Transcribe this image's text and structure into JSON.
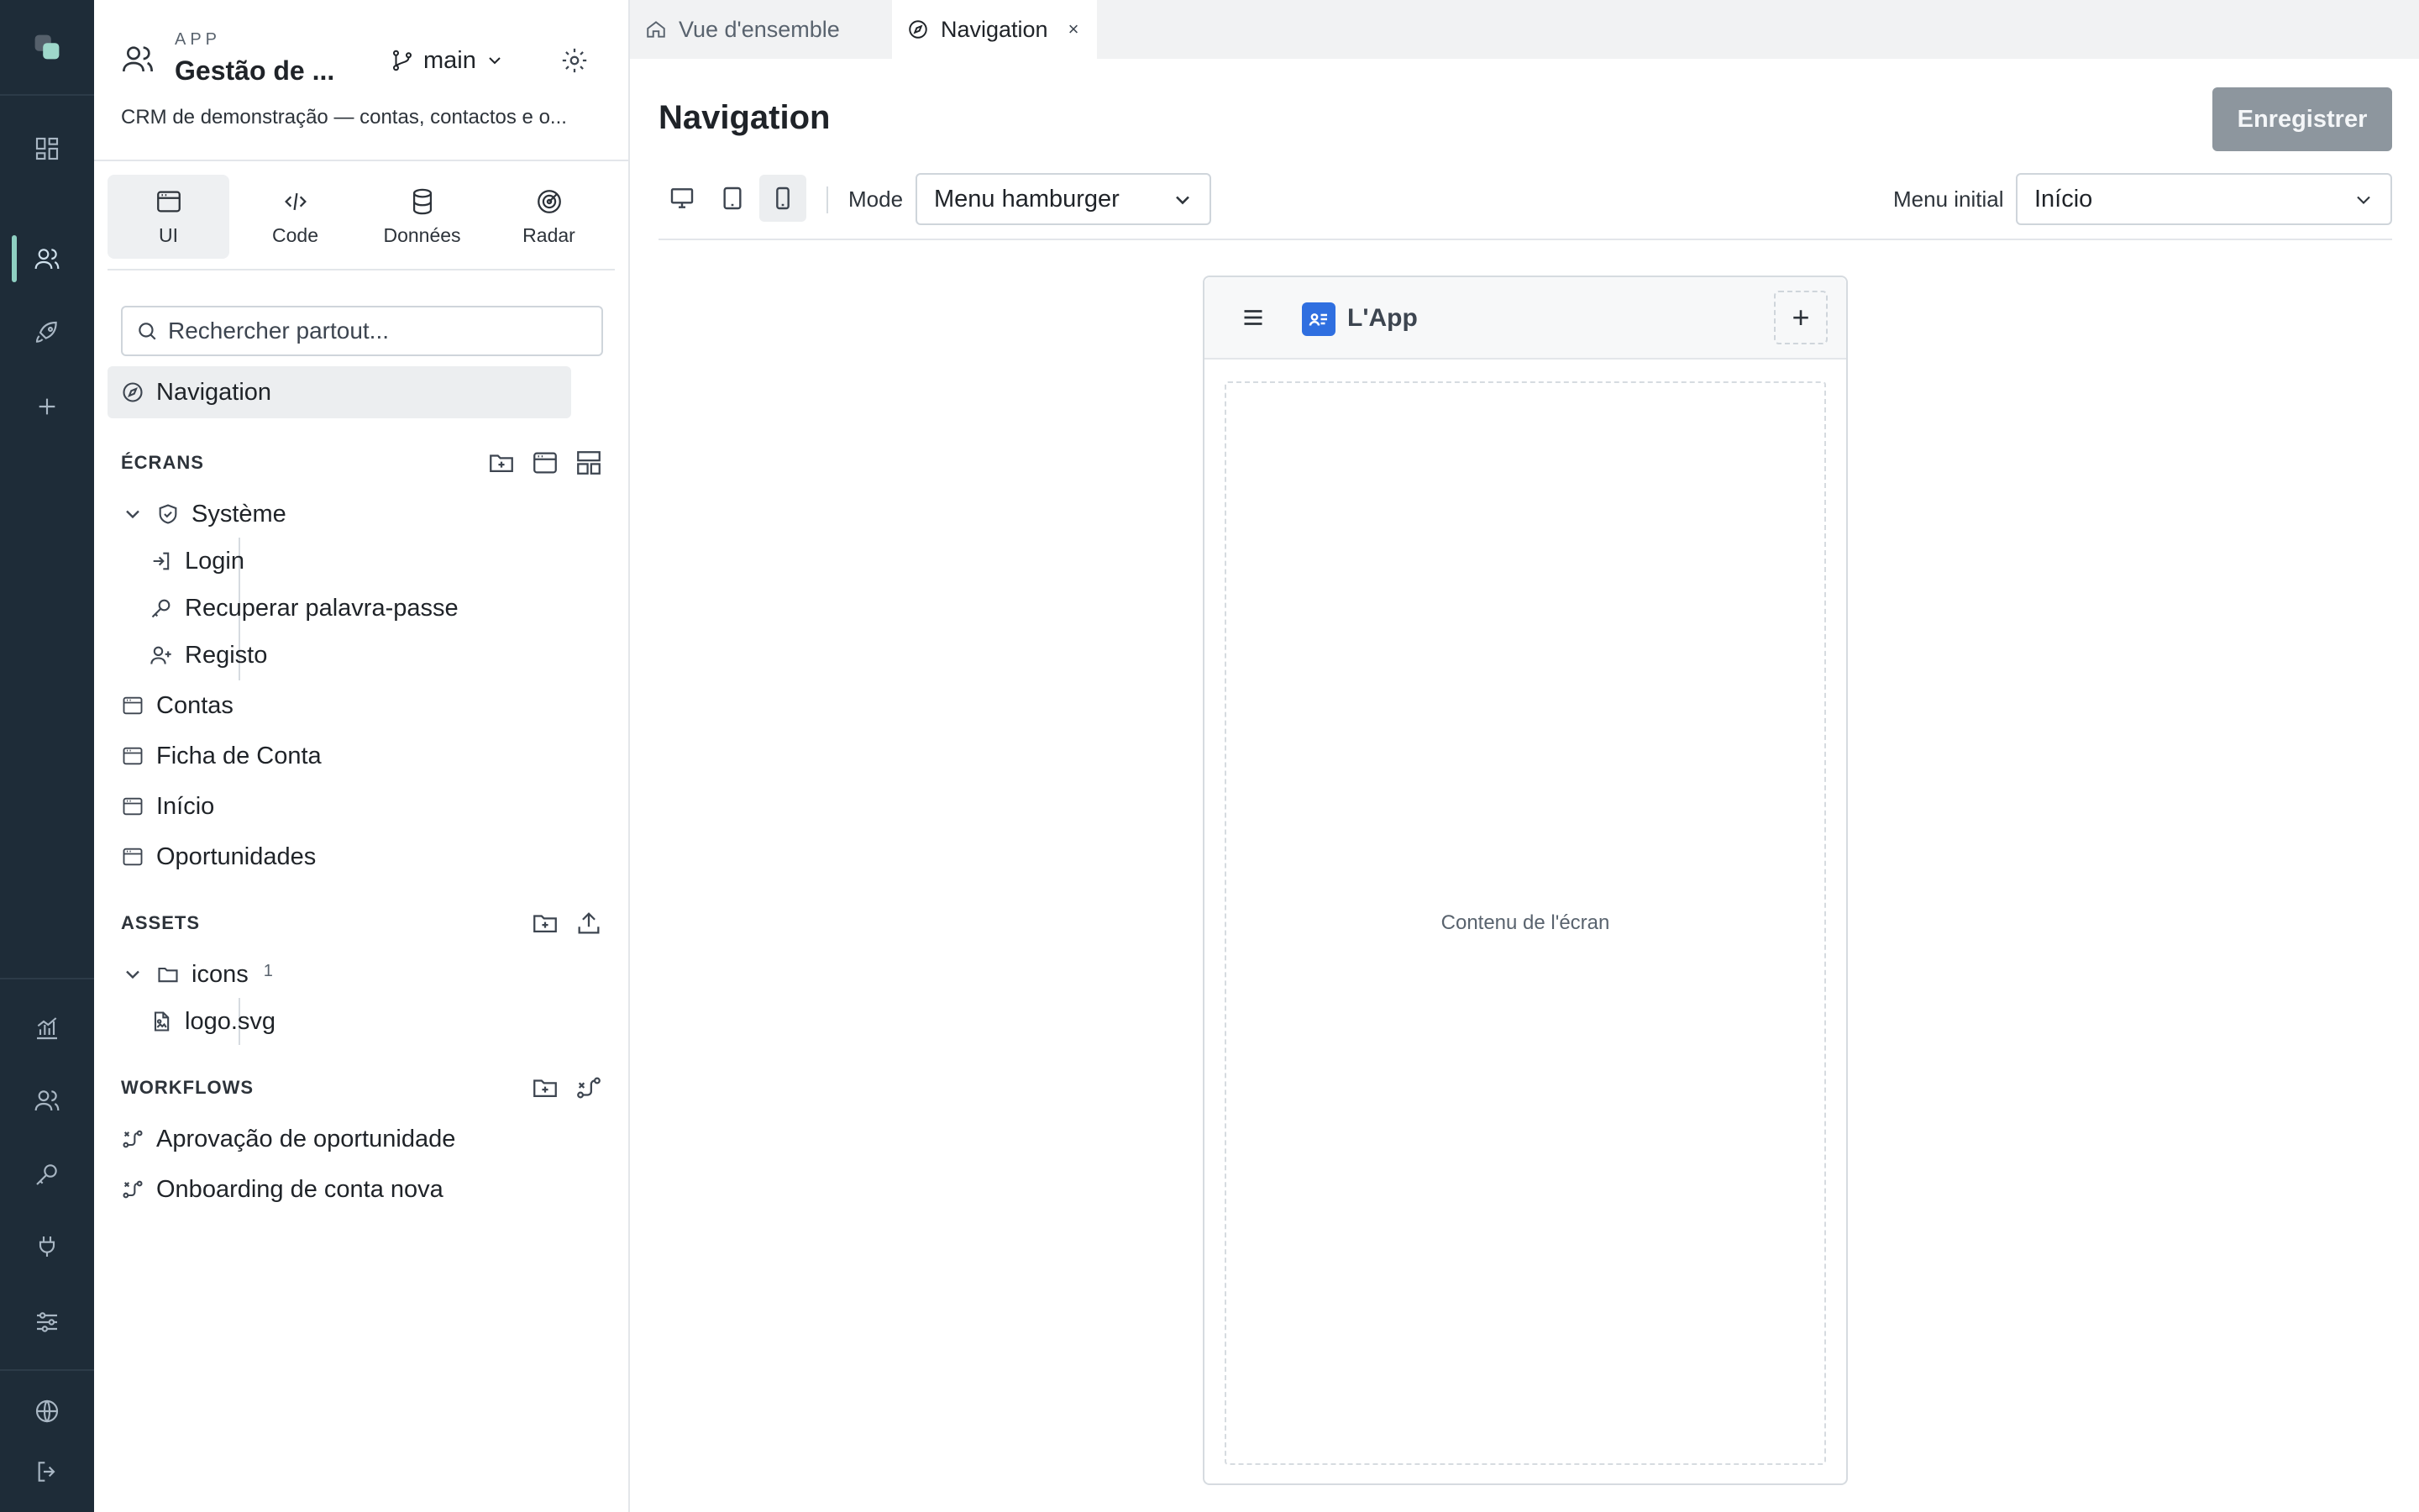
{
  "rail": {
    "icons": [
      "app-logo-icon",
      "dashboard-icon",
      "users-icon",
      "rocket-icon",
      "plus-icon",
      "analytics-icon",
      "team-icon",
      "key-icon",
      "plug-icon",
      "sliders-icon",
      "globe-icon",
      "logout-icon"
    ]
  },
  "app": {
    "kicker": "APP",
    "title": "Gestão de ...",
    "branch": "main",
    "description": "CRM de demonstração — contas, contactos e o..."
  },
  "modes": [
    {
      "label": "UI",
      "icon": "window-icon"
    },
    {
      "label": "Code",
      "icon": "code-icon"
    },
    {
      "label": "Données",
      "icon": "database-icon"
    },
    {
      "label": "Radar",
      "icon": "radar-icon"
    }
  ],
  "search": {
    "placeholder": "Rechercher partout..."
  },
  "nav_item": {
    "label": "Navigation"
  },
  "screens": {
    "title": "ÉCRANS",
    "group": "Système",
    "system_items": [
      "Login",
      "Recuperar palavra-passe",
      "Registo"
    ],
    "items": [
      "Contas",
      "Ficha de Conta",
      "Início",
      "Oportunidades"
    ]
  },
  "assets": {
    "title": "ASSETS",
    "folder": "icons",
    "folder_count": "1",
    "file": "logo.svg"
  },
  "workflows": {
    "title": "WORKFLOWS",
    "items": [
      "Aprovação de oportunidade",
      "Onboarding de conta nova"
    ]
  },
  "tabs": [
    {
      "label": "Vue d'ensemble",
      "icon": "home-icon",
      "active": false
    },
    {
      "label": "Navigation",
      "icon": "compass-icon",
      "active": true,
      "close": "×"
    }
  ],
  "main": {
    "title": "Navigation",
    "save_label": "Enregistrer",
    "mode_label": "Mode",
    "mode_value": "Menu hamburger",
    "initial_menu_label": "Menu initial",
    "initial_menu_value": "Início",
    "device": "mobile"
  },
  "preview": {
    "app_name": "L'App",
    "add_symbol": "+",
    "content_placeholder": "Contenu de l'écran"
  },
  "colors": {
    "rail_bg": "#1e2c38",
    "rail_accent": "#8fd0c2",
    "save_button": "#8d969e",
    "app_logo": "#2f6fe0"
  }
}
